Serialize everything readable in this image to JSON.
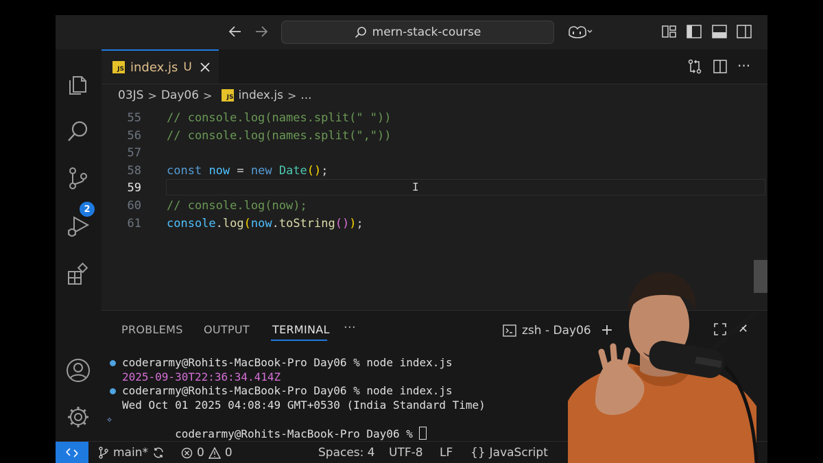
{
  "titlebar": {
    "back_icon": "arrow-left-icon",
    "forward_icon": "arrow-right-icon",
    "search_text": "mern-stack-course",
    "copilot_icon": "copilot-icon"
  },
  "activity_bar": {
    "items": [
      "explorer",
      "search",
      "source-control",
      "run-debug",
      "extensions"
    ],
    "source_control_badge": "2",
    "bottom": [
      "accounts",
      "manage"
    ]
  },
  "tab": {
    "name": "index.js",
    "status": "U",
    "icon_text": "JS"
  },
  "breadcrumb": {
    "folder1": "03JS",
    "folder2": "Day06",
    "file": "index.js",
    "more": "..."
  },
  "code_lines": [
    {
      "no": "55",
      "text": "// console.log(names.split(\" \"))"
    },
    {
      "no": "56",
      "text": "// console.log(names.split(\",\"))"
    },
    {
      "no": "57",
      "text": ""
    },
    {
      "no": "58",
      "text": "const now = new Date();"
    },
    {
      "no": "59",
      "text": ""
    },
    {
      "no": "60",
      "text": "// console.log(now);"
    },
    {
      "no": "61",
      "text": "console.log(now.toString());"
    }
  ],
  "code_tokens": {
    "l55": "// console.log(names.split(\" \"))",
    "l56": "// console.log(names.split(\",\"))",
    "l58_const": "const",
    "l58_now": "now",
    "l58_eq": " = ",
    "l58_new": "new",
    "l58_date": "Date",
    "l58_semi": ";",
    "l60": "// console.log(now);",
    "l61_console": "console",
    "l61_dot": ".",
    "l61_log": "log",
    "l61_now": "now",
    "l61_tostring": "toString",
    "l61_semi": ";"
  },
  "panel": {
    "tabs": [
      "PROBLEMS",
      "OUTPUT",
      "TERMINAL"
    ],
    "active_tab": "TERMINAL",
    "more": "···",
    "terminal_name": "zsh - Day06",
    "add": "+",
    "close": "✕"
  },
  "terminal": {
    "prompt1": "coderarmy@Rohits-MacBook-Pro Day06 % node index.js",
    "output1": "2025-09-30T22:36:34.414Z",
    "prompt2": "coderarmy@Rohits-MacBook-Pro Day06 % node index.js",
    "output2": "Wed Oct 01 2025 04:08:49 GMT+0530 (India Standard Time)",
    "prompt3": "coderarmy@Rohits-MacBook-Pro Day06 % "
  },
  "statusbar": {
    "branch": "main*",
    "errors": "0",
    "warnings": "0",
    "spaces": "Spaces: 4",
    "encoding": "UTF-8",
    "eol": "LF",
    "language": "JavaScript"
  },
  "colors": {
    "accent": "#1f7ae0",
    "comment": "#6a9955",
    "keyword": "#569cd6",
    "variable": "#4fc1ff",
    "function": "#dcdcaa",
    "class": "#4ec9b0",
    "modified": "#e2c08d"
  }
}
